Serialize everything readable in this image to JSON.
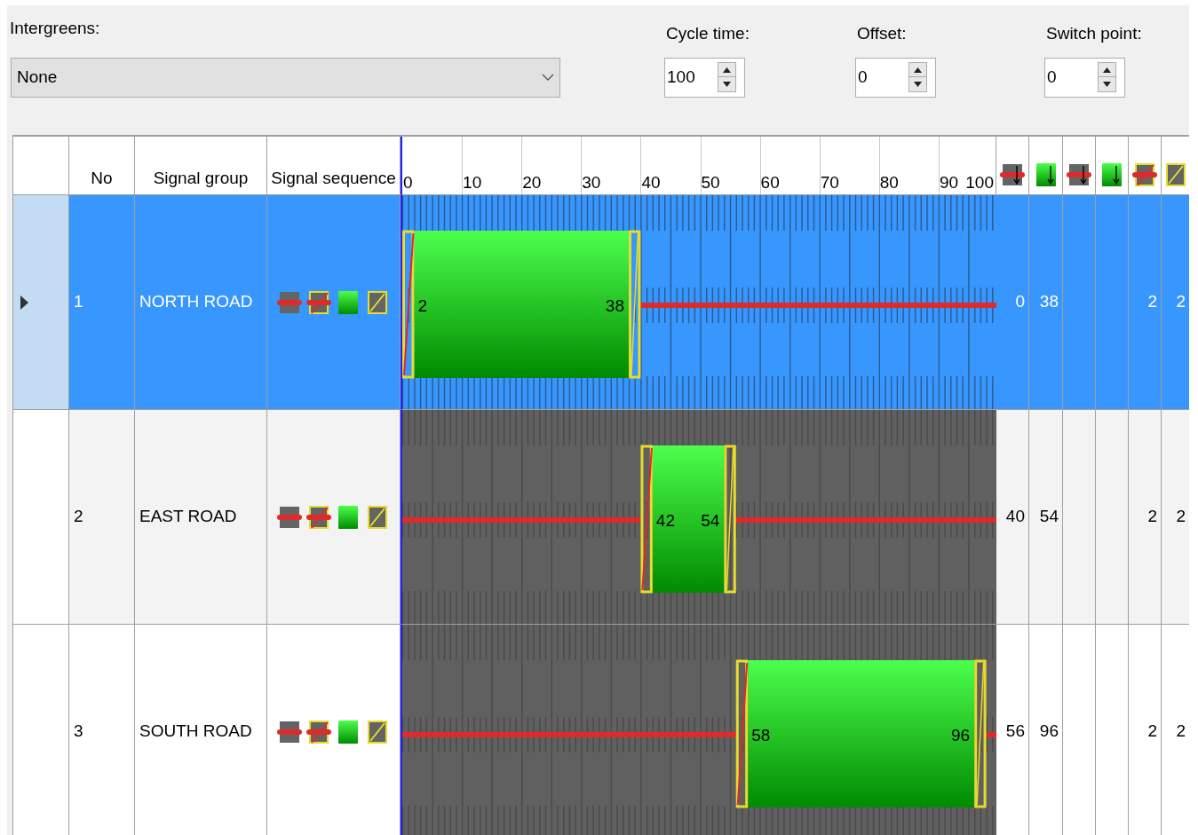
{
  "intergreens": {
    "label": "Intergreens:",
    "value": "None"
  },
  "cycle_time": {
    "label": "Cycle time:",
    "value": "100"
  },
  "offset": {
    "label": "Offset:",
    "value": "0"
  },
  "switch_point": {
    "label": "Switch point:",
    "value": "0"
  },
  "table": {
    "columns": [
      {
        "label": "No"
      },
      {
        "label": "Signal group"
      },
      {
        "label": "Signal sequence"
      }
    ],
    "timeline_ticks": [
      "0",
      "10",
      "20",
      "30",
      "40",
      "50",
      "60",
      "70",
      "80",
      "90",
      "100"
    ],
    "icon_columns": [
      {
        "kind": "stop_end"
      },
      {
        "kind": "go_end"
      },
      {
        "kind": "stop_end"
      },
      {
        "kind": "go_end"
      },
      {
        "kind": "prepare"
      },
      {
        "kind": "clearance"
      }
    ],
    "rows": [
      {
        "selected": true,
        "no": "1",
        "signal_group": "NORTH ROAD",
        "signal_sequence": [
          {
            "kind": "stop"
          },
          {
            "kind": "prepare"
          },
          {
            "kind": "go"
          },
          {
            "kind": "clearance"
          }
        ],
        "green_start": "2",
        "green_end": "38",
        "cells": {
          "column_1": "0",
          "column_2": "38",
          "column_5": "2",
          "column_6": "2"
        }
      },
      {
        "selected": false,
        "no": "2",
        "signal_group": "EAST ROAD",
        "signal_sequence": [
          {
            "kind": "stop"
          },
          {
            "kind": "prepare"
          },
          {
            "kind": "go"
          },
          {
            "kind": "clearance"
          }
        ],
        "green_start": "42",
        "green_end": "54",
        "cells": {
          "column_1": "40",
          "column_2": "54",
          "column_5": "2",
          "column_6": "2"
        }
      },
      {
        "selected": false,
        "no": "3",
        "signal_group": "SOUTH ROAD",
        "signal_sequence": [
          {
            "kind": "stop"
          },
          {
            "kind": "prepare"
          },
          {
            "kind": "go"
          },
          {
            "kind": "clearance"
          }
        ],
        "green_start": "58",
        "green_end": "96",
        "cells": {
          "column_1": "56",
          "column_2": "96",
          "column_5": "2",
          "column_6": "2"
        }
      }
    ]
  }
}
